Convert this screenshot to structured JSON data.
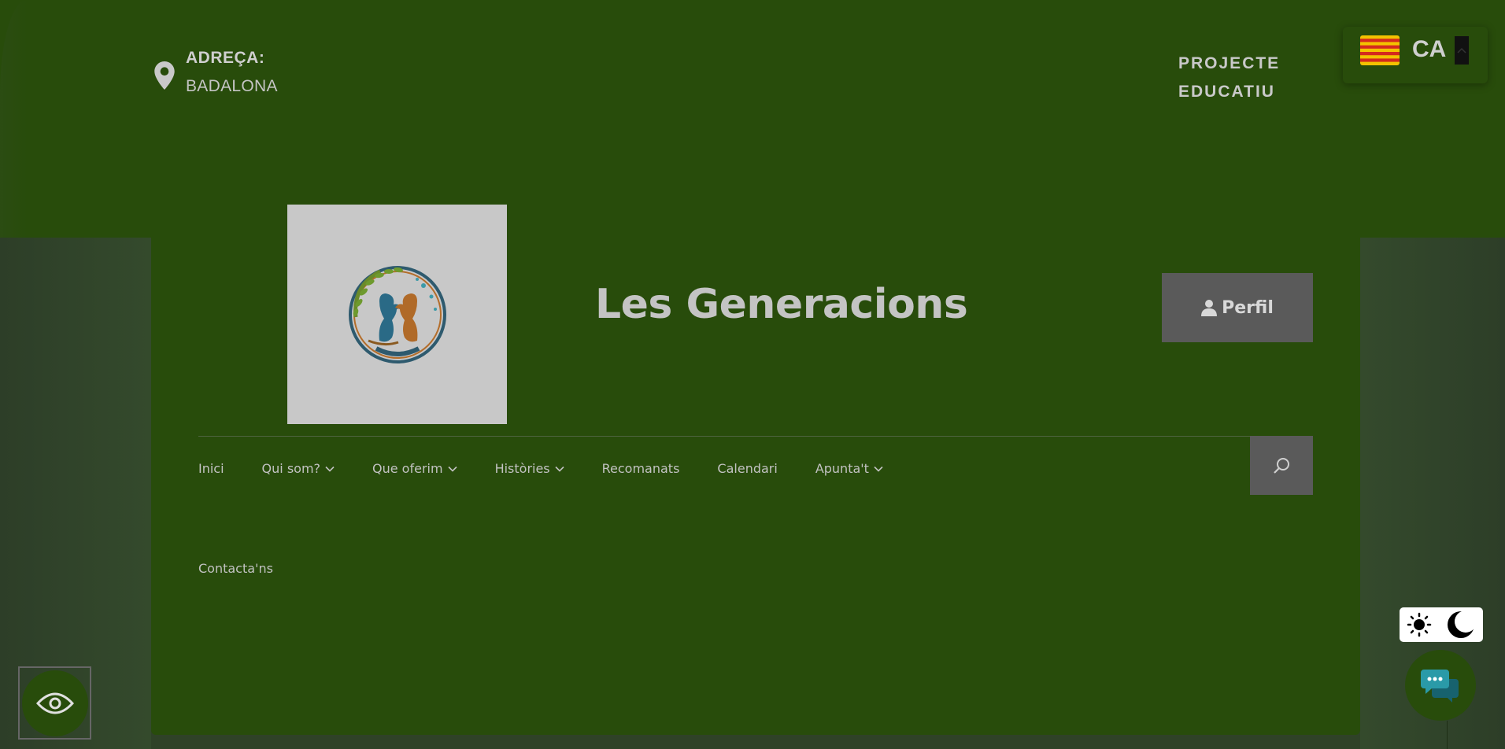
{
  "header": {
    "address_label": "ADREÇA:",
    "address_value": "BADALONA",
    "projecte_line1": "PROJECTE",
    "projecte_line2": "EDUCATIU"
  },
  "language": {
    "code": "CA"
  },
  "site": {
    "title": "Les Generacions"
  },
  "profile": {
    "label": "Perfil"
  },
  "nav": {
    "items": [
      {
        "label": "Inici",
        "has_dropdown": false
      },
      {
        "label": "Qui som?",
        "has_dropdown": true
      },
      {
        "label": "Que oferim",
        "has_dropdown": true
      },
      {
        "label": "Històries",
        "has_dropdown": true
      },
      {
        "label": "Recomanats",
        "has_dropdown": false
      },
      {
        "label": "Calendari",
        "has_dropdown": false
      },
      {
        "label": "Apunta't",
        "has_dropdown": true
      }
    ],
    "second_row": "Contacta'ns"
  },
  "colors": {
    "background": "#2f4227",
    "primary_green": "#284c0b",
    "button_gray": "#5a5a5a",
    "text_light": "#c9c9c9"
  },
  "icons": {
    "address": "map-pin-icon",
    "flag": "catalonia-flag-icon",
    "profile": "user-icon",
    "search": "search-icon",
    "light": "sun-icon",
    "dark": "moon-icon",
    "chat": "chat-bubbles-icon",
    "accessibility": "eye-icon"
  }
}
